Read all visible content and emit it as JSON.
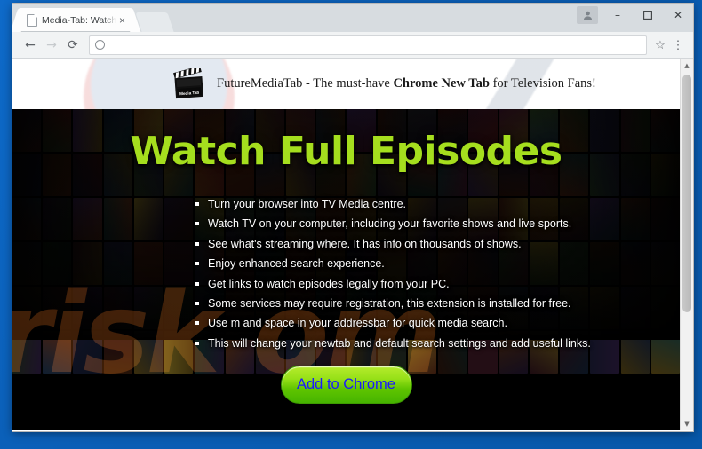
{
  "browser": {
    "tab": {
      "title": "Media-Tab: Watch TV, fo",
      "favicon": "document-icon",
      "close_label": "×"
    },
    "window_controls": {
      "profile": "person-icon",
      "minimize": "–",
      "maximize": "❐",
      "close": "✕"
    },
    "toolbar": {
      "back": "←",
      "forward": "→",
      "reload": "⟳",
      "bookmark": "☆",
      "menu": "⋮",
      "omnibox_value": "",
      "omnibox_placeholder": "",
      "site_info": "info-icon"
    },
    "scrollbar": {
      "up_arrow": "▲",
      "down_arrow": "▼"
    }
  },
  "page": {
    "header": {
      "logo_alt": "media-tab-clapperboard-logo",
      "logo_caption": "Media Tab",
      "text_before": "FutureMediaTab - The must-have ",
      "text_bold": "Chrome New Tab",
      "text_after": " for Television Fans!"
    },
    "hero": {
      "title": "Watch Full Episodes",
      "watermark": "risk  om",
      "features": [
        "Turn your browser into TV Media centre.",
        "Watch TV on your computer, including your favorite shows and live sports.",
        "See what's streaming where. It has info on thousands of shows.",
        "Enjoy enhanced search experience.",
        "Get links to watch episodes legally from your PC.",
        "Some services may require registration, this extension is installed for free.",
        "Use m and space in your addressbar for quick media search.",
        "This will change your newtab and default search settings and add useful links."
      ],
      "cta_label": "Add to Chrome"
    }
  },
  "colors": {
    "title_green": "#a5de1e",
    "cta_green_top": "#b5ec2c",
    "cta_green_bottom": "#46b400",
    "cta_text_blue": "#1a1aff",
    "desktop_blue": "#0a62c0",
    "watermark_orange": "#9c4a12"
  }
}
